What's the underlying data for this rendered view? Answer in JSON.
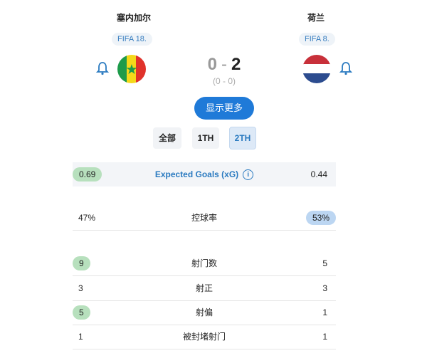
{
  "home": {
    "name": "塞内加尔",
    "rank": "FIFA 18."
  },
  "away": {
    "name": "荷兰",
    "rank": "FIFA 8."
  },
  "score": {
    "home": "0",
    "away": "2",
    "separator": "-",
    "halftime": "(0 - 0)"
  },
  "more_button": "显示更多",
  "periods": [
    {
      "label": "全部",
      "active": false
    },
    {
      "label": "1TH",
      "active": false
    },
    {
      "label": "2TH",
      "active": true
    }
  ],
  "xg": {
    "label": "Expected Goals (xG)",
    "home": "0.69",
    "away": "0.44"
  },
  "possession": {
    "label": "控球率",
    "home": "47%",
    "away": "53%"
  },
  "stats": [
    {
      "label": "射门数",
      "home": "9",
      "away": "5"
    },
    {
      "label": "射正",
      "home": "3",
      "away": "3"
    },
    {
      "label": "射偏",
      "home": "5",
      "away": "1"
    },
    {
      "label": "被封堵射门",
      "home": "1",
      "away": "1"
    }
  ],
  "colors": {
    "accent": "#1f7ad8",
    "home_highlight": "#b7e0bd",
    "away_highlight": "#bcd6f2"
  },
  "icons": {
    "bell": "bell-icon",
    "info": "info-icon"
  }
}
